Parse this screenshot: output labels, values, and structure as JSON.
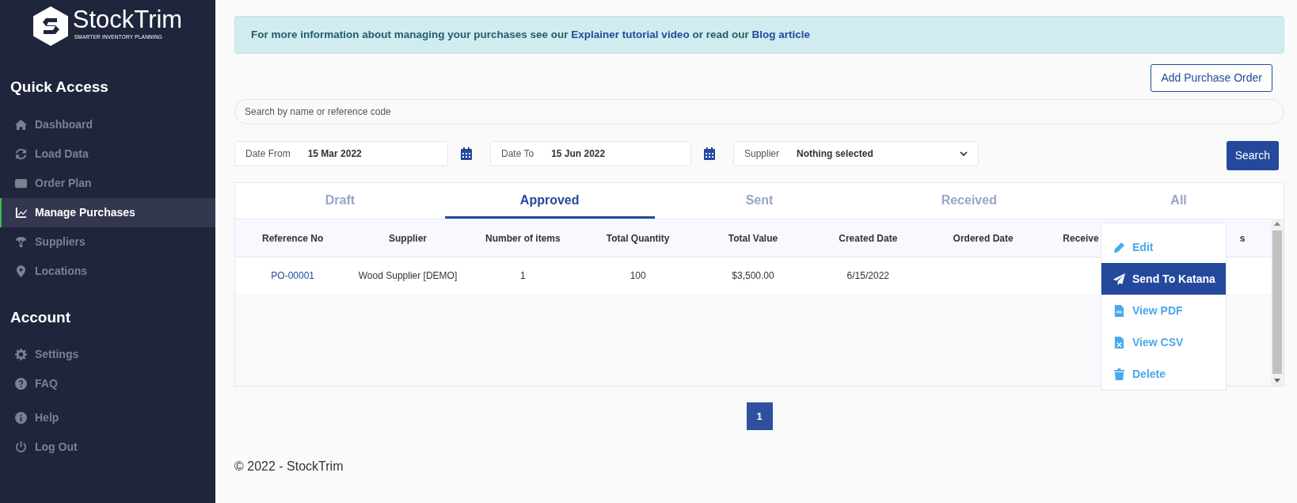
{
  "logo": {
    "name": "StockTrim",
    "tagline": "SMARTER INVENTORY PLANNING"
  },
  "sidebar": {
    "sections": [
      {
        "title": "Quick Access",
        "items": [
          {
            "label": "Dashboard",
            "selected": false
          },
          {
            "label": "Load Data",
            "selected": false
          },
          {
            "label": "Order Plan",
            "selected": false
          },
          {
            "label": "Manage Purchases",
            "selected": true
          },
          {
            "label": "Suppliers",
            "selected": false
          },
          {
            "label": "Locations",
            "selected": false
          }
        ]
      },
      {
        "title": "Account",
        "items": [
          {
            "label": "Settings",
            "selected": false
          },
          {
            "label": "FAQ",
            "selected": false
          },
          {
            "label": "Help",
            "selected": false
          },
          {
            "label": "Log Out",
            "selected": false
          }
        ]
      }
    ]
  },
  "info_alert": {
    "parts": [
      {
        "kind": "text",
        "text": "For more information about managing your purchases see our"
      },
      {
        "kind": "link",
        "text": "Explainer tutorial video"
      },
      {
        "kind": "text",
        "text": "or read our"
      },
      {
        "kind": "link",
        "text": "Blog article"
      }
    ]
  },
  "add_button": "Add Purchase Order",
  "search": {
    "placeholder": "Search by name or reference code"
  },
  "filters": [
    {
      "kind": "date",
      "label": "Date From",
      "value": "15 Mar 2022"
    },
    {
      "kind": "date",
      "label": "Date To",
      "value": "15 Jun 2022"
    },
    {
      "kind": "select",
      "label": "Supplier",
      "value": "Nothing selected"
    }
  ],
  "search_button": "Search",
  "tabs": [
    {
      "label": "Draft",
      "selected": false
    },
    {
      "label": "Approved",
      "selected": true
    },
    {
      "label": "Sent",
      "selected": false
    },
    {
      "label": "Received",
      "selected": false
    },
    {
      "label": "All",
      "selected": false
    }
  ],
  "table": {
    "columns": [
      "Reference No",
      "Supplier",
      "Number of items",
      "Total Quantity",
      "Total Value",
      "Created Date",
      "Ordered Date",
      "Receive",
      "s"
    ],
    "rows": [
      {
        "cells": [
          "PO-00001",
          "Wood Supplier [DEMO]",
          "1",
          "100",
          "$3,500.00",
          "6/15/2022",
          "",
          "",
          ""
        ]
      }
    ]
  },
  "action_menu": [
    {
      "label": "Edit",
      "selected": false
    },
    {
      "label": "Send To Katana",
      "selected": true
    },
    {
      "label": "View PDF",
      "selected": false
    },
    {
      "label": "View CSV",
      "selected": false
    },
    {
      "label": "Delete",
      "selected": false
    }
  ],
  "pagination": [
    {
      "label": "1",
      "selected": true
    }
  ],
  "footer": "© 2022 - StockTrim"
}
